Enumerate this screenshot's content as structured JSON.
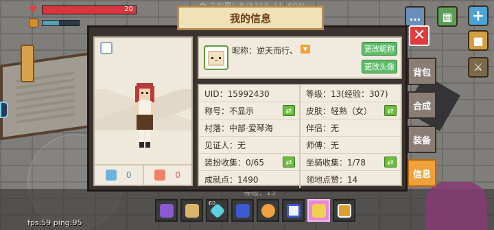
{
  "hud": {
    "hp_value": "20",
    "hp_fraction": 1.0,
    "food_fraction": 0.45,
    "fps_text": "fps:59 ping:95"
  },
  "scene": {
    "top_text": "南 主世界：8 (8113, 11, 604)",
    "bottom_text": "等级：13"
  },
  "panel": {
    "title": "我的信息",
    "close_label": "✕",
    "tabs": [
      {
        "label": "背包"
      },
      {
        "label": "合成"
      },
      {
        "label": "装备"
      },
      {
        "label": "信息",
        "active": true
      }
    ]
  },
  "character": {
    "stats": [
      {
        "icon": "face-icon",
        "value": "0"
      },
      {
        "icon": "sad-face-icon",
        "value": "0"
      }
    ]
  },
  "profile": {
    "nickname": "昵称：逆天而行、",
    "change_nick_label": "更改昵称",
    "change_avatar_label": "更改头像"
  },
  "info": {
    "uid": "UID：15992430",
    "level": "等级：13(经验：307)",
    "title_label": "称号：不显示",
    "skin": "皮肤：轻熟（女）",
    "village": "村落：中部·爱琴海",
    "partner": "伴侣：无",
    "witness": "见证人：无",
    "master": "师傅：无",
    "outfit": "装扮收集：0/65",
    "mount": "坐骑收集：1/78",
    "achievement": "成就点：1490",
    "likes": "领地点赞：14"
  },
  "hotbar": {
    "badge": "60",
    "items": [
      "purple-crystal",
      "scroll",
      "diamond",
      "book",
      "gem",
      "cake",
      "pink-gem",
      "beer"
    ],
    "selected_index": 6
  }
}
